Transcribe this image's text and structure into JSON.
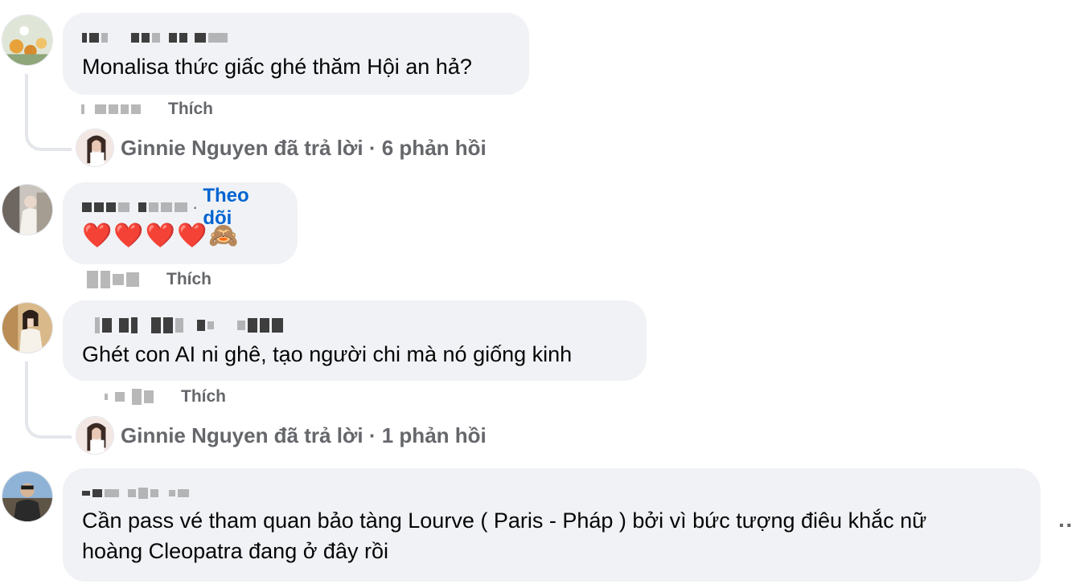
{
  "comments": [
    {
      "text": "Monalisa thức giấc ghé thăm Hội an hả?",
      "like_label": "Thích",
      "reply_summary": "Ginnie Nguyen đã trả lời · 6 phản hồi"
    },
    {
      "follow_label": "Theo dõi",
      "text": "❤️❤️❤️❤️🙈",
      "like_label": "Thích"
    },
    {
      "text": "Ghét con AI ni ghê, tạo người chi mà nó giống kinh",
      "like_label": "Thích",
      "reply_summary": "Ginnie Nguyen đã trả lời · 1 phản hồi"
    },
    {
      "text_line1": "Cần pass vé tham quan bảo tàng Lourve ( Paris - Pháp ) bởi vì bức tượng điêu khắc nữ",
      "text_line2": "hoàng Cleopatra đang ở đây rồi",
      "more_label": "··"
    }
  ],
  "colors": {
    "bubble": "#f0f2f5",
    "secondary_text": "#65676b",
    "link": "#0064d1",
    "thread_line": "#e4e6eb"
  }
}
